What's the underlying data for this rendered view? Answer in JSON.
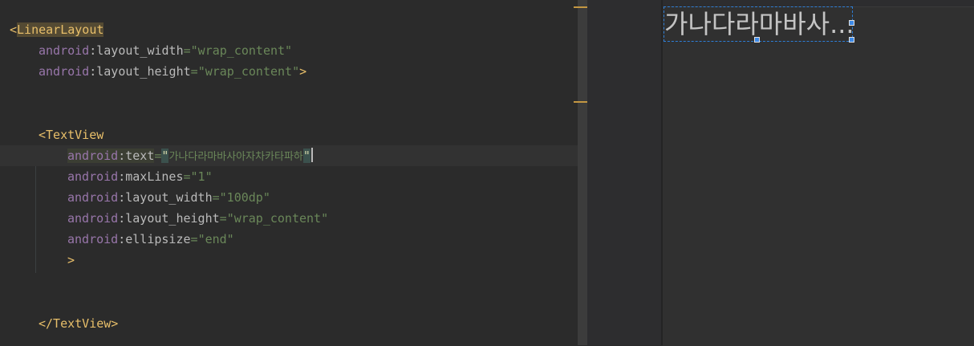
{
  "editor": {
    "lines": {
      "l1": {
        "bracket": "<",
        "tag": "LinearLayout"
      },
      "l2": {
        "ns": "android",
        "colon": ":",
        "attr": "layout_width",
        "eq": "=",
        "value": "\"wrap_content\""
      },
      "l3": {
        "ns": "android",
        "colon": ":",
        "attr": "layout_height",
        "eq": "=",
        "value": "\"wrap_content\"",
        "close": ">"
      },
      "l6": {
        "bracket": "<",
        "tag": "TextView"
      },
      "l7": {
        "ns": "android",
        "colon": ":",
        "attr": "text",
        "eq": "=",
        "open_quote": "\"",
        "value": "가나다라마바사아자차카타파하",
        "close_quote": "\""
      },
      "l8": {
        "ns": "android",
        "colon": ":",
        "attr": "maxLines",
        "eq": "=",
        "value": "\"1\""
      },
      "l9": {
        "ns": "android",
        "colon": ":",
        "attr": "layout_width",
        "eq": "=",
        "value": "\"100dp\""
      },
      "l10": {
        "ns": "android",
        "colon": ":",
        "attr": "layout_height",
        "eq": "=",
        "value": "\"wrap_content\""
      },
      "l11": {
        "ns": "android",
        "colon": ":",
        "attr": "ellipsize",
        "eq": "=",
        "value": "\"end\""
      },
      "l12": {
        "close": ">"
      },
      "l15": {
        "close_tag": "</TextView>"
      }
    }
  },
  "preview": {
    "textview_text": "가나다라마바사..."
  },
  "colors": {
    "editor_bg": "#2b2b2b",
    "tag": "#e8bf6a",
    "namespace": "#9876aa",
    "string": "#6a8759",
    "selection_border": "#2e7ed6"
  }
}
